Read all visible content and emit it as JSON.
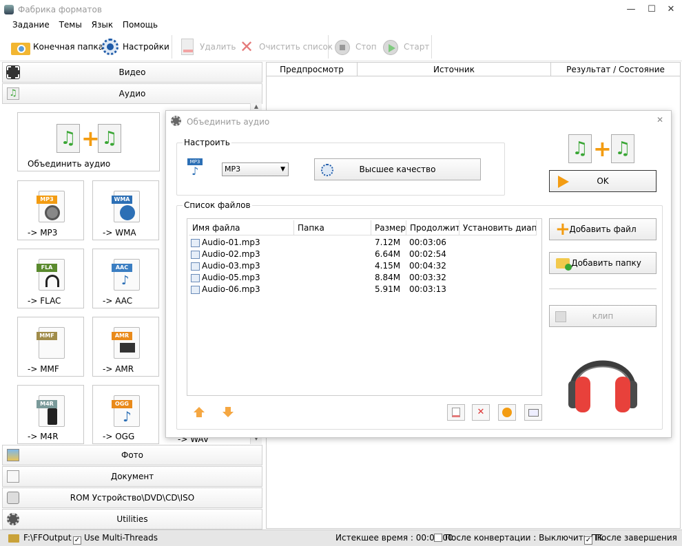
{
  "window": {
    "title": "Фабрика форматов"
  },
  "menu": [
    "Задание",
    "Темы",
    "Язык",
    "Помощь"
  ],
  "toolbar": {
    "output_folder": "Конечная папка",
    "settings": "Настройки",
    "delete": "Удалить",
    "clear_list": "Очистить список",
    "stop": "Стоп",
    "start": "Старт"
  },
  "categories": {
    "video": "Видео",
    "audio": "Аудио",
    "photo": "Фото",
    "document": "Документ",
    "rom": "ROM Устройство\\DVD\\CD\\ISO",
    "utilities": "Utilities"
  },
  "audio_tiles": {
    "join": "Объединить аудио",
    "mp3": "-> MP3",
    "wma": "-> WMA",
    "flac": "-> FLAC",
    "aac": "-> AAC",
    "mmf": "-> MMF",
    "amr": "-> AMR",
    "m4r": "-> M4R",
    "ogg": "-> OGG",
    "wav": "-> WAV"
  },
  "file_tags": {
    "mp3": "MP3",
    "wma": "WMA",
    "fla": "FLA",
    "aac": "AAC",
    "mmf": "MMF",
    "amr": "AMR",
    "m4r": "M4R",
    "ogg": "OGG"
  },
  "task_list": {
    "headers": [
      "Предпросмотр",
      "Источник",
      "Результат / Состояние"
    ]
  },
  "dialog": {
    "title": "Объединить аудио",
    "configure_label": "Настроить",
    "format_tag": "MP3",
    "format_select": "MP3",
    "quality_button": "Высшее качество",
    "ok_button": "OK",
    "file_list_label": "Список файлов",
    "columns": [
      "Имя файла",
      "Папка",
      "Размер",
      "Продолжит...",
      "Установить диапа..."
    ],
    "files": [
      {
        "name": "Audio-01.mp3",
        "size": "7.12M",
        "duration": "00:03:06"
      },
      {
        "name": "Audio-02.mp3",
        "size": "6.64M",
        "duration": "00:02:54"
      },
      {
        "name": "Audio-03.mp3",
        "size": "4.15M",
        "duration": "00:04:32"
      },
      {
        "name": "Audio-05.mp3",
        "size": "8.84M",
        "duration": "00:03:32"
      },
      {
        "name": "Audio-06.mp3",
        "size": "5.91M",
        "duration": "00:03:13"
      }
    ],
    "add_file_button": "Добавить файл",
    "add_folder_button": "Добавить папку",
    "clip_button": "клип"
  },
  "status": {
    "output_path": "F:\\FFOutput",
    "multithreads": "Use Multi-Threads",
    "elapsed": "Истекшее время : 00:00:00",
    "shutdown_after": "После конвертации : Выключить ПК",
    "after_finish": "После завершения"
  },
  "colors": {
    "accent_orange": "#f39c12",
    "headphone_red": "#e8413b",
    "music_green": "#3aa635"
  }
}
